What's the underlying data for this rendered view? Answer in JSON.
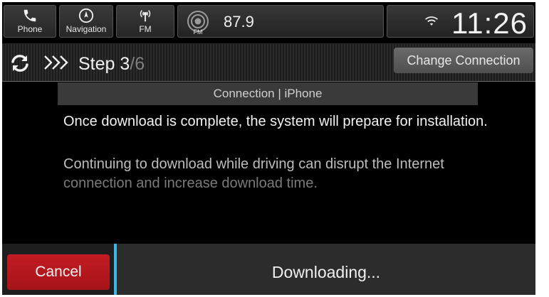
{
  "status_bar": {
    "buttons": [
      {
        "label": "Phone",
        "icon": "phone-icon"
      },
      {
        "label": "Navigation",
        "icon": "compass-icon"
      },
      {
        "label": "FM",
        "icon": "radio-antenna-icon"
      }
    ],
    "radio": {
      "band_icon_label": "FM",
      "frequency": "87.9"
    },
    "clock": "11:26",
    "wifi_icon": "wifi-icon"
  },
  "header": {
    "refresh_icon": "refresh-icon",
    "chevron_icon": "triple-chevron-icon",
    "step_prefix": "Step",
    "step_current": "3",
    "step_separator": "/",
    "step_total": "6",
    "change_connection_label": "Change Connection"
  },
  "content": {
    "connection_label": "Connection | iPhone",
    "message_primary": "Once download is complete, the system will prepare for installation.",
    "message_secondary_line1": "Continuing to download while driving can disrupt the Internet",
    "message_secondary_line2": "connection and increase download time."
  },
  "footer": {
    "cancel_label": "Cancel",
    "status_label": "Downloading..."
  },
  "colors": {
    "accent_blue": "#3fb4e5",
    "cancel_red": "#c31c22",
    "background": "#000000"
  }
}
